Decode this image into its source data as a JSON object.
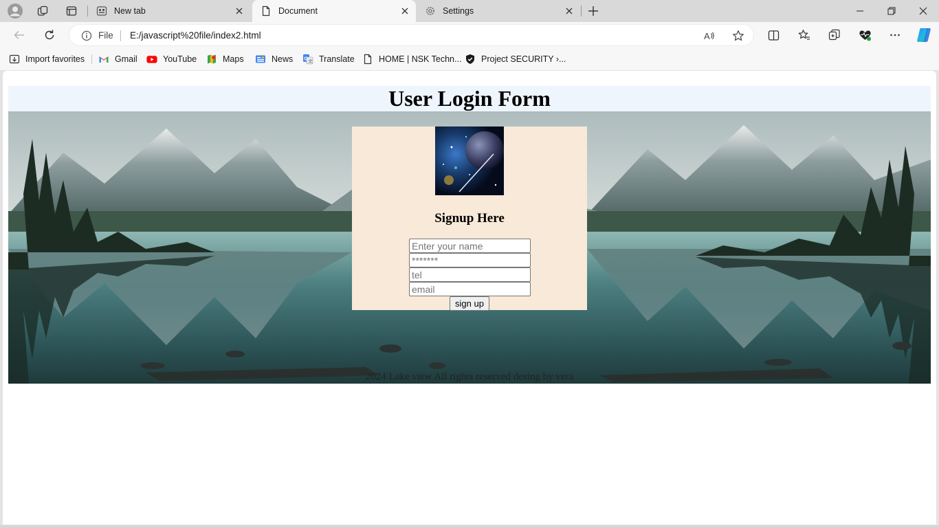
{
  "browser": {
    "tabs": [
      {
        "title": "New tab",
        "icon": "newtab-icon"
      },
      {
        "title": "Document",
        "icon": "document-icon",
        "active": true
      },
      {
        "title": "Settings",
        "icon": "gear-icon"
      }
    ],
    "address": {
      "scheme_label": "File",
      "url": "E:/javascript%20file/index2.html"
    },
    "favorites": [
      {
        "label": "Import favorites",
        "icon": "import-icon"
      },
      {
        "label": "Gmail",
        "icon": "gmail-icon"
      },
      {
        "label": "YouTube",
        "icon": "youtube-icon"
      },
      {
        "label": "Maps",
        "icon": "maps-icon"
      },
      {
        "label": "News",
        "icon": "news-icon"
      },
      {
        "label": "Translate",
        "icon": "translate-icon"
      },
      {
        "label": "HOME | NSK Techn...",
        "icon": "page-icon"
      },
      {
        "label": "Project SECURITY ›...",
        "icon": "shield-icon"
      }
    ]
  },
  "page": {
    "title": "User Login Form",
    "signup": {
      "heading": "Signup Here",
      "name_placeholder": "Enter your name",
      "password_placeholder": "*******",
      "tel_placeholder": "tel",
      "email_placeholder": "email",
      "button_label": "sign up"
    },
    "footer": "2024 Lake view All rights reserved desing by vera"
  },
  "colors": {
    "header_bg": "#eef5fd",
    "signup_bg": "#f8e9d8",
    "accent": "#0c59a4"
  }
}
